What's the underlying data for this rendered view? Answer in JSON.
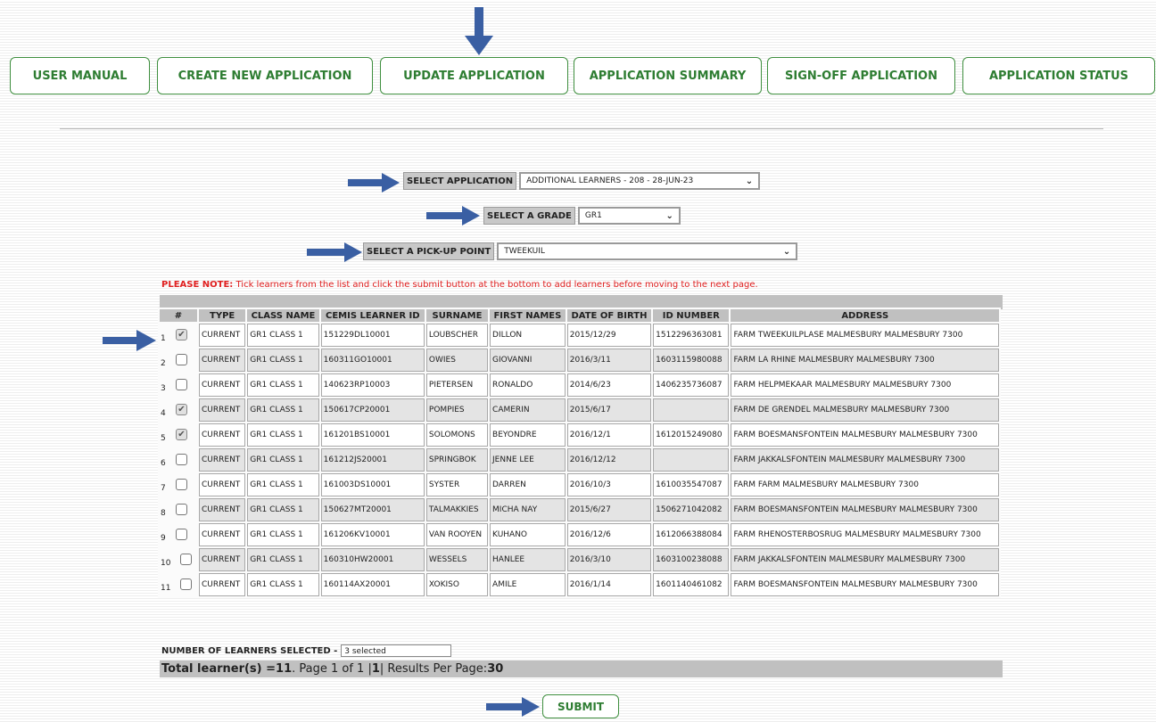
{
  "nav": {
    "items": [
      "USER MANUAL",
      "CREATE NEW APPLICATION",
      "UPDATE APPLICATION",
      "APPLICATION SUMMARY",
      "SIGN-OFF APPLICATION",
      "APPLICATION STATUS"
    ]
  },
  "form": {
    "application": {
      "label": "SELECT APPLICATION",
      "value": "ADDITIONAL LEARNERS - 208 - 28-JUN-23"
    },
    "grade": {
      "label": "SELECT A GRADE",
      "value": "GR1"
    },
    "pickup": {
      "label": "SELECT A PICK-UP POINT",
      "value": "TWEEKUIL"
    }
  },
  "note": {
    "prefix": "PLEASE NOTE:",
    "text": " Tick learners from the list and click the submit button at the bottom to add learners before moving to the next page."
  },
  "table": {
    "headers": [
      "#",
      "TYPE",
      "CLASS NAME",
      "CEMIS LEARNER ID",
      "SURNAME",
      "FIRST NAMES",
      "DATE OF BIRTH",
      "ID NUMBER",
      "ADDRESS"
    ],
    "rows": [
      {
        "num": "1",
        "checked": true,
        "type": "CURRENT",
        "class": "GR1 CLASS 1",
        "cemis": "151229DL10001",
        "surname": "LOUBSCHER",
        "first": "DILLON",
        "dob": "2015/12/29",
        "id": "1512296363081",
        "address": "FARM TWEEKUILPLASE MALMESBURY MALMESBURY 7300"
      },
      {
        "num": "2",
        "checked": false,
        "type": "CURRENT",
        "class": "GR1 CLASS 1",
        "cemis": "160311GO10001",
        "surname": "OWIES",
        "first": "GIOVANNI",
        "dob": "2016/3/11",
        "id": "1603115980088",
        "address": "FARM LA RHINE MALMESBURY MALMESBURY 7300"
      },
      {
        "num": "3",
        "checked": false,
        "type": "CURRENT",
        "class": "GR1 CLASS 1",
        "cemis": "140623RP10003",
        "surname": "PIETERSEN",
        "first": "RONALDO",
        "dob": "2014/6/23",
        "id": "1406235736087",
        "address": "FARM HELPMEKAAR MALMESBURY MALMESBURY 7300"
      },
      {
        "num": "4",
        "checked": true,
        "type": "CURRENT",
        "class": "GR1 CLASS 1",
        "cemis": "150617CP20001",
        "surname": "POMPIES",
        "first": "CAMERIN",
        "dob": "2015/6/17",
        "id": "",
        "address": "FARM DE GRENDEL MALMESBURY MALMESBURY 7300"
      },
      {
        "num": "5",
        "checked": true,
        "type": "CURRENT",
        "class": "GR1 CLASS 1",
        "cemis": "161201BS10001",
        "surname": "SOLOMONS",
        "first": "BEYONDRE",
        "dob": "2016/12/1",
        "id": "1612015249080",
        "address": "FARM BOESMANSFONTEIN MALMESBURY MALMESBURY 7300"
      },
      {
        "num": "6",
        "checked": false,
        "type": "CURRENT",
        "class": "GR1 CLASS 1",
        "cemis": "161212JS20001",
        "surname": "SPRINGBOK",
        "first": "JENNE LEE",
        "dob": "2016/12/12",
        "id": "",
        "address": "FARM JAKKALSFONTEIN MALMESBURY MALMESBURY 7300"
      },
      {
        "num": "7",
        "checked": false,
        "type": "CURRENT",
        "class": "GR1 CLASS 1",
        "cemis": "161003DS10001",
        "surname": "SYSTER",
        "first": "DARREN",
        "dob": "2016/10/3",
        "id": "1610035547087",
        "address": "FARM FARM MALMESBURY MALMESBURY 7300"
      },
      {
        "num": "8",
        "checked": false,
        "type": "CURRENT",
        "class": "GR1 CLASS 1",
        "cemis": "150627MT20001",
        "surname": "TALMAKKIES",
        "first": "MICHA NAY",
        "dob": "2015/6/27",
        "id": "1506271042082",
        "address": "FARM BOESMANSFONTEIN MALMESBURY MALMESBURY 7300"
      },
      {
        "num": "9",
        "checked": false,
        "type": "CURRENT",
        "class": "GR1 CLASS 1",
        "cemis": "161206KV10001",
        "surname": "VAN ROOYEN",
        "first": "KUHANO",
        "dob": "2016/12/6",
        "id": "1612066388084",
        "address": "FARM RHENOSTERBOSRUG MALMESBURY MALMESBURY 7300"
      },
      {
        "num": "10",
        "checked": false,
        "type": "CURRENT",
        "class": "GR1 CLASS 1",
        "cemis": "160310HW20001",
        "surname": "WESSELS",
        "first": "HANLEE",
        "dob": "2016/3/10",
        "id": "1603100238088",
        "address": "FARM JAKKALSFONTEIN MALMESBURY MALMESBURY 7300"
      },
      {
        "num": "11",
        "checked": false,
        "type": "CURRENT",
        "class": "GR1 CLASS 1",
        "cemis": "160114AX20001",
        "surname": "XOKISO",
        "first": "AMILE",
        "dob": "2016/1/14",
        "id": "1601140461082",
        "address": "FARM BOESMANSFONTEIN MALMESBURY MALMESBURY 7300"
      }
    ]
  },
  "selection": {
    "label": "NUMBER OF LEARNERS SELECTED -",
    "value": "3 selected"
  },
  "pagination": {
    "total_label": "Total learner(s) = ",
    "total": "11",
    "page_text": ". Page 1 of 1 | ",
    "page_current": "1",
    "per_page_text": " | Results Per Page: ",
    "per_page": "30"
  },
  "submit_label": "SUBMIT",
  "colors": {
    "accent_green": "#2e7d32",
    "alert_red": "#e02020",
    "arrow_blue": "#3a5fa3"
  }
}
